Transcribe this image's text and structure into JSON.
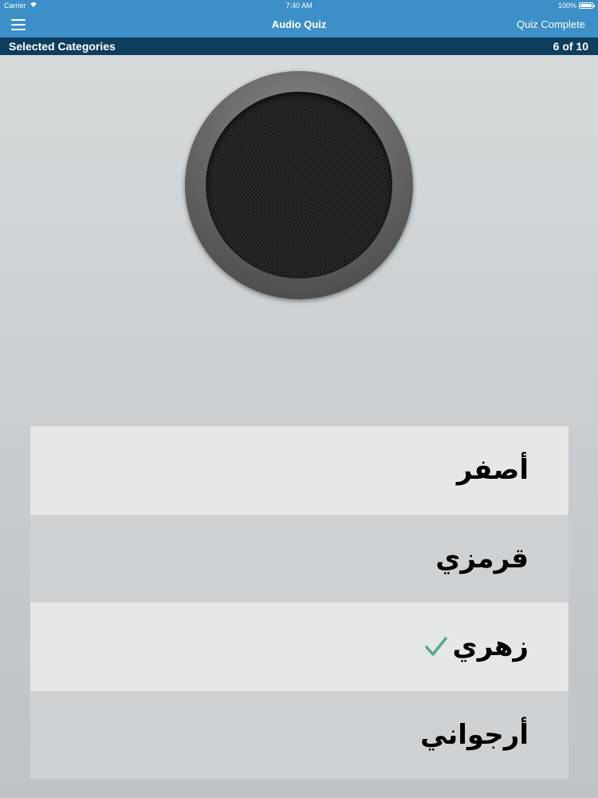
{
  "status_bar": {
    "carrier": "Carrier",
    "time": "7:40 AM",
    "battery": "100%"
  },
  "nav": {
    "title": "Audio Quiz",
    "right_action": "Quiz Complete",
    "menu_icon": "hamburger-menu-icon"
  },
  "subheader": {
    "left": "Selected Categories",
    "progress": "6 of 10"
  },
  "speaker": {
    "icon": "speaker-icon"
  },
  "answers": [
    {
      "text": "أصفر",
      "selected": false
    },
    {
      "text": "قرمزي",
      "selected": false
    },
    {
      "text": "زهري",
      "selected": true
    },
    {
      "text": "أرجواني",
      "selected": false
    }
  ],
  "colors": {
    "nav_bar": "#3d8fc8",
    "subheader": "#0d3e5e",
    "check": "#5aa88a"
  }
}
